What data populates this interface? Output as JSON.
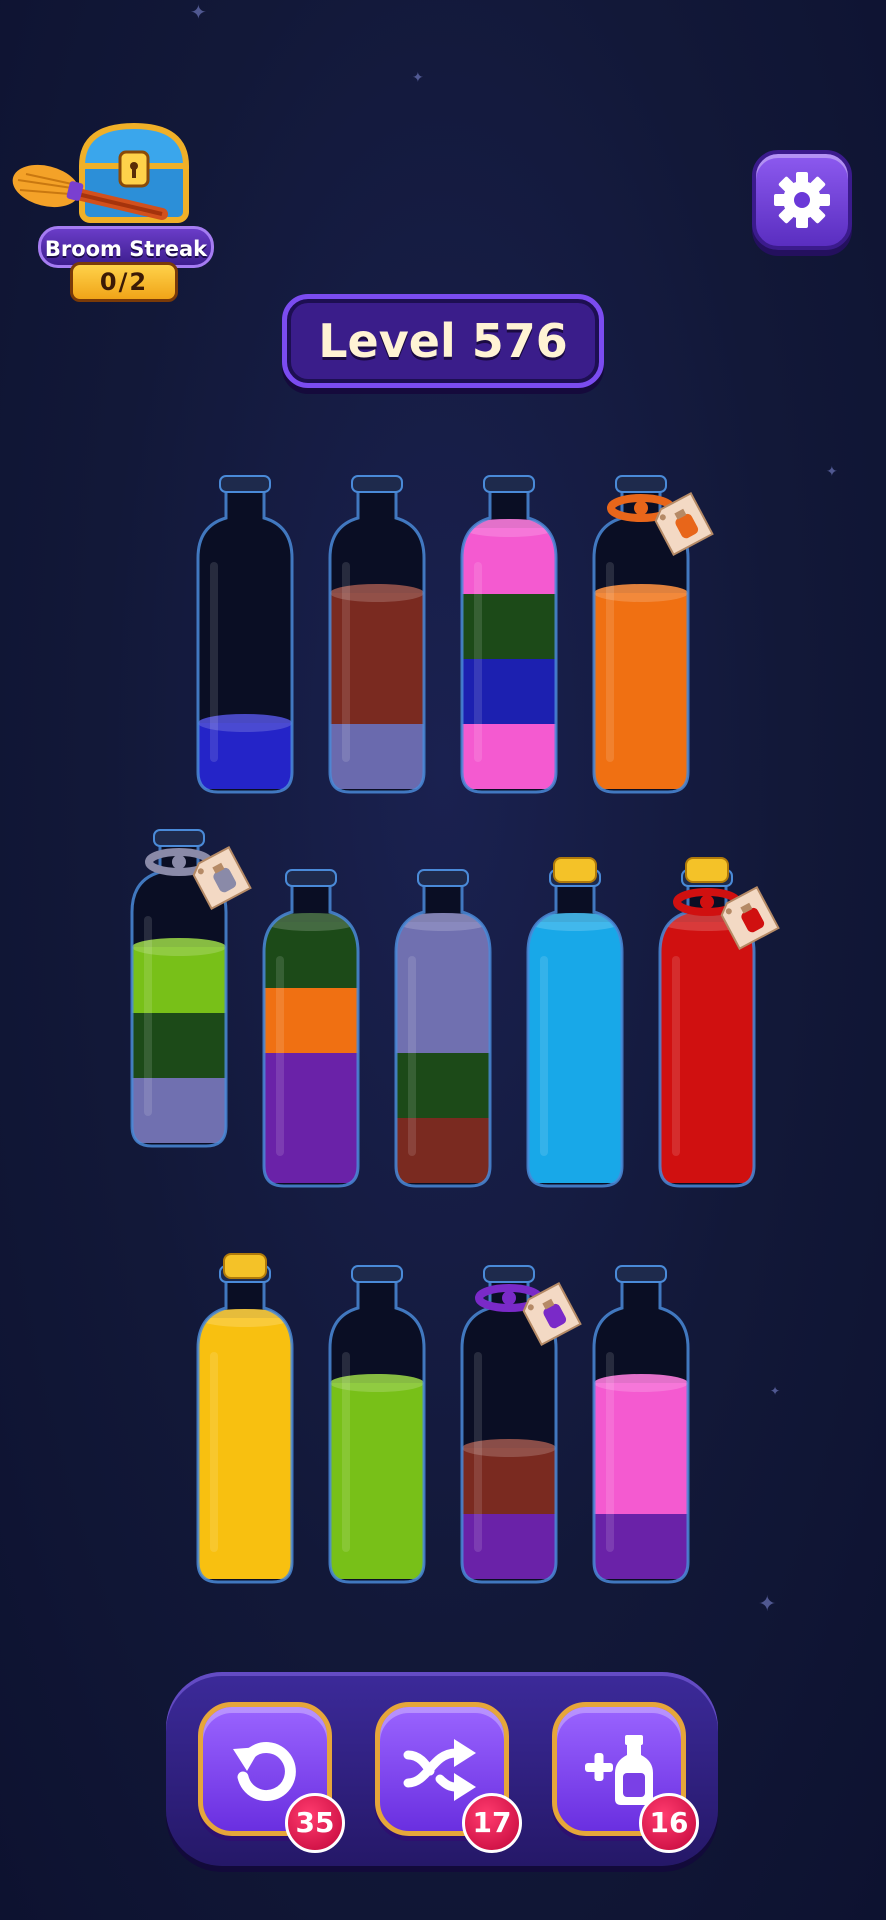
{
  "broom_streak": {
    "label": "Broom Streak",
    "count": "0/2"
  },
  "level": {
    "title": "Level 576"
  },
  "bottles": [
    {
      "row": 1,
      "layers_bottom_to_top": [
        "#2424c8"
      ],
      "cap": "none"
    },
    {
      "row": 1,
      "layers_bottom_to_top": [
        "#6a6aae",
        "#7a2a20",
        "#7a2a20"
      ],
      "cap": "none"
    },
    {
      "row": 1,
      "layers_bottom_to_top": [
        "#f45ad0",
        "#1c20b0",
        "#1c4a18",
        "#f45ad0"
      ],
      "cap": "none"
    },
    {
      "row": 1,
      "layers_bottom_to_top": [
        "#f07012",
        "#f07012",
        "#f07012"
      ],
      "cap": "rope",
      "rope_color": "#e8661a"
    },
    {
      "row": 2,
      "layers_bottom_to_top": [
        "#7070b0",
        "#1c4a18",
        "#78c018"
      ],
      "cap": "rope",
      "rope_color": "#8a8aa8"
    },
    {
      "row": 2,
      "layers_bottom_to_top": [
        "#6a22a8",
        "#6a22a8",
        "#f07012",
        "#1c4a18"
      ],
      "cap": "none"
    },
    {
      "row": 2,
      "layers_bottom_to_top": [
        "#7a2a20",
        "#1c4a18",
        "#7070b0",
        "#7070b0"
      ],
      "cap": "none"
    },
    {
      "row": 2,
      "layers_bottom_to_top": [
        "#18a8e8",
        "#18a8e8",
        "#18a8e8",
        "#18a8e8"
      ],
      "cap": "cork"
    },
    {
      "row": 2,
      "layers_bottom_to_top": [
        "#d01010",
        "#d01010",
        "#d01010",
        "#d01010"
      ],
      "cap": "cork_rope",
      "rope_color": "#d01010"
    },
    {
      "row": 3,
      "layers_bottom_to_top": [
        "#f8c010",
        "#f8c010",
        "#f8c010",
        "#f8c010"
      ],
      "cap": "cork"
    },
    {
      "row": 3,
      "layers_bottom_to_top": [
        "#78c018",
        "#78c018",
        "#78c018"
      ],
      "cap": "none"
    },
    {
      "row": 3,
      "layers_bottom_to_top": [
        "#6a22a8",
        "#7a2a20"
      ],
      "cap": "rope",
      "rope_color": "#7a2ac8"
    },
    {
      "row": 3,
      "layers_bottom_to_top": [
        "#6a22a8",
        "#f45ad0",
        "#f45ad0"
      ],
      "cap": "none"
    }
  ],
  "powerups": [
    {
      "name": "undo",
      "icon": "undo-icon",
      "count": "35"
    },
    {
      "name": "shuffle",
      "icon": "shuffle-icon",
      "count": "17"
    },
    {
      "name": "add-bottle",
      "icon": "add-bottle-icon",
      "count": "16"
    }
  ]
}
